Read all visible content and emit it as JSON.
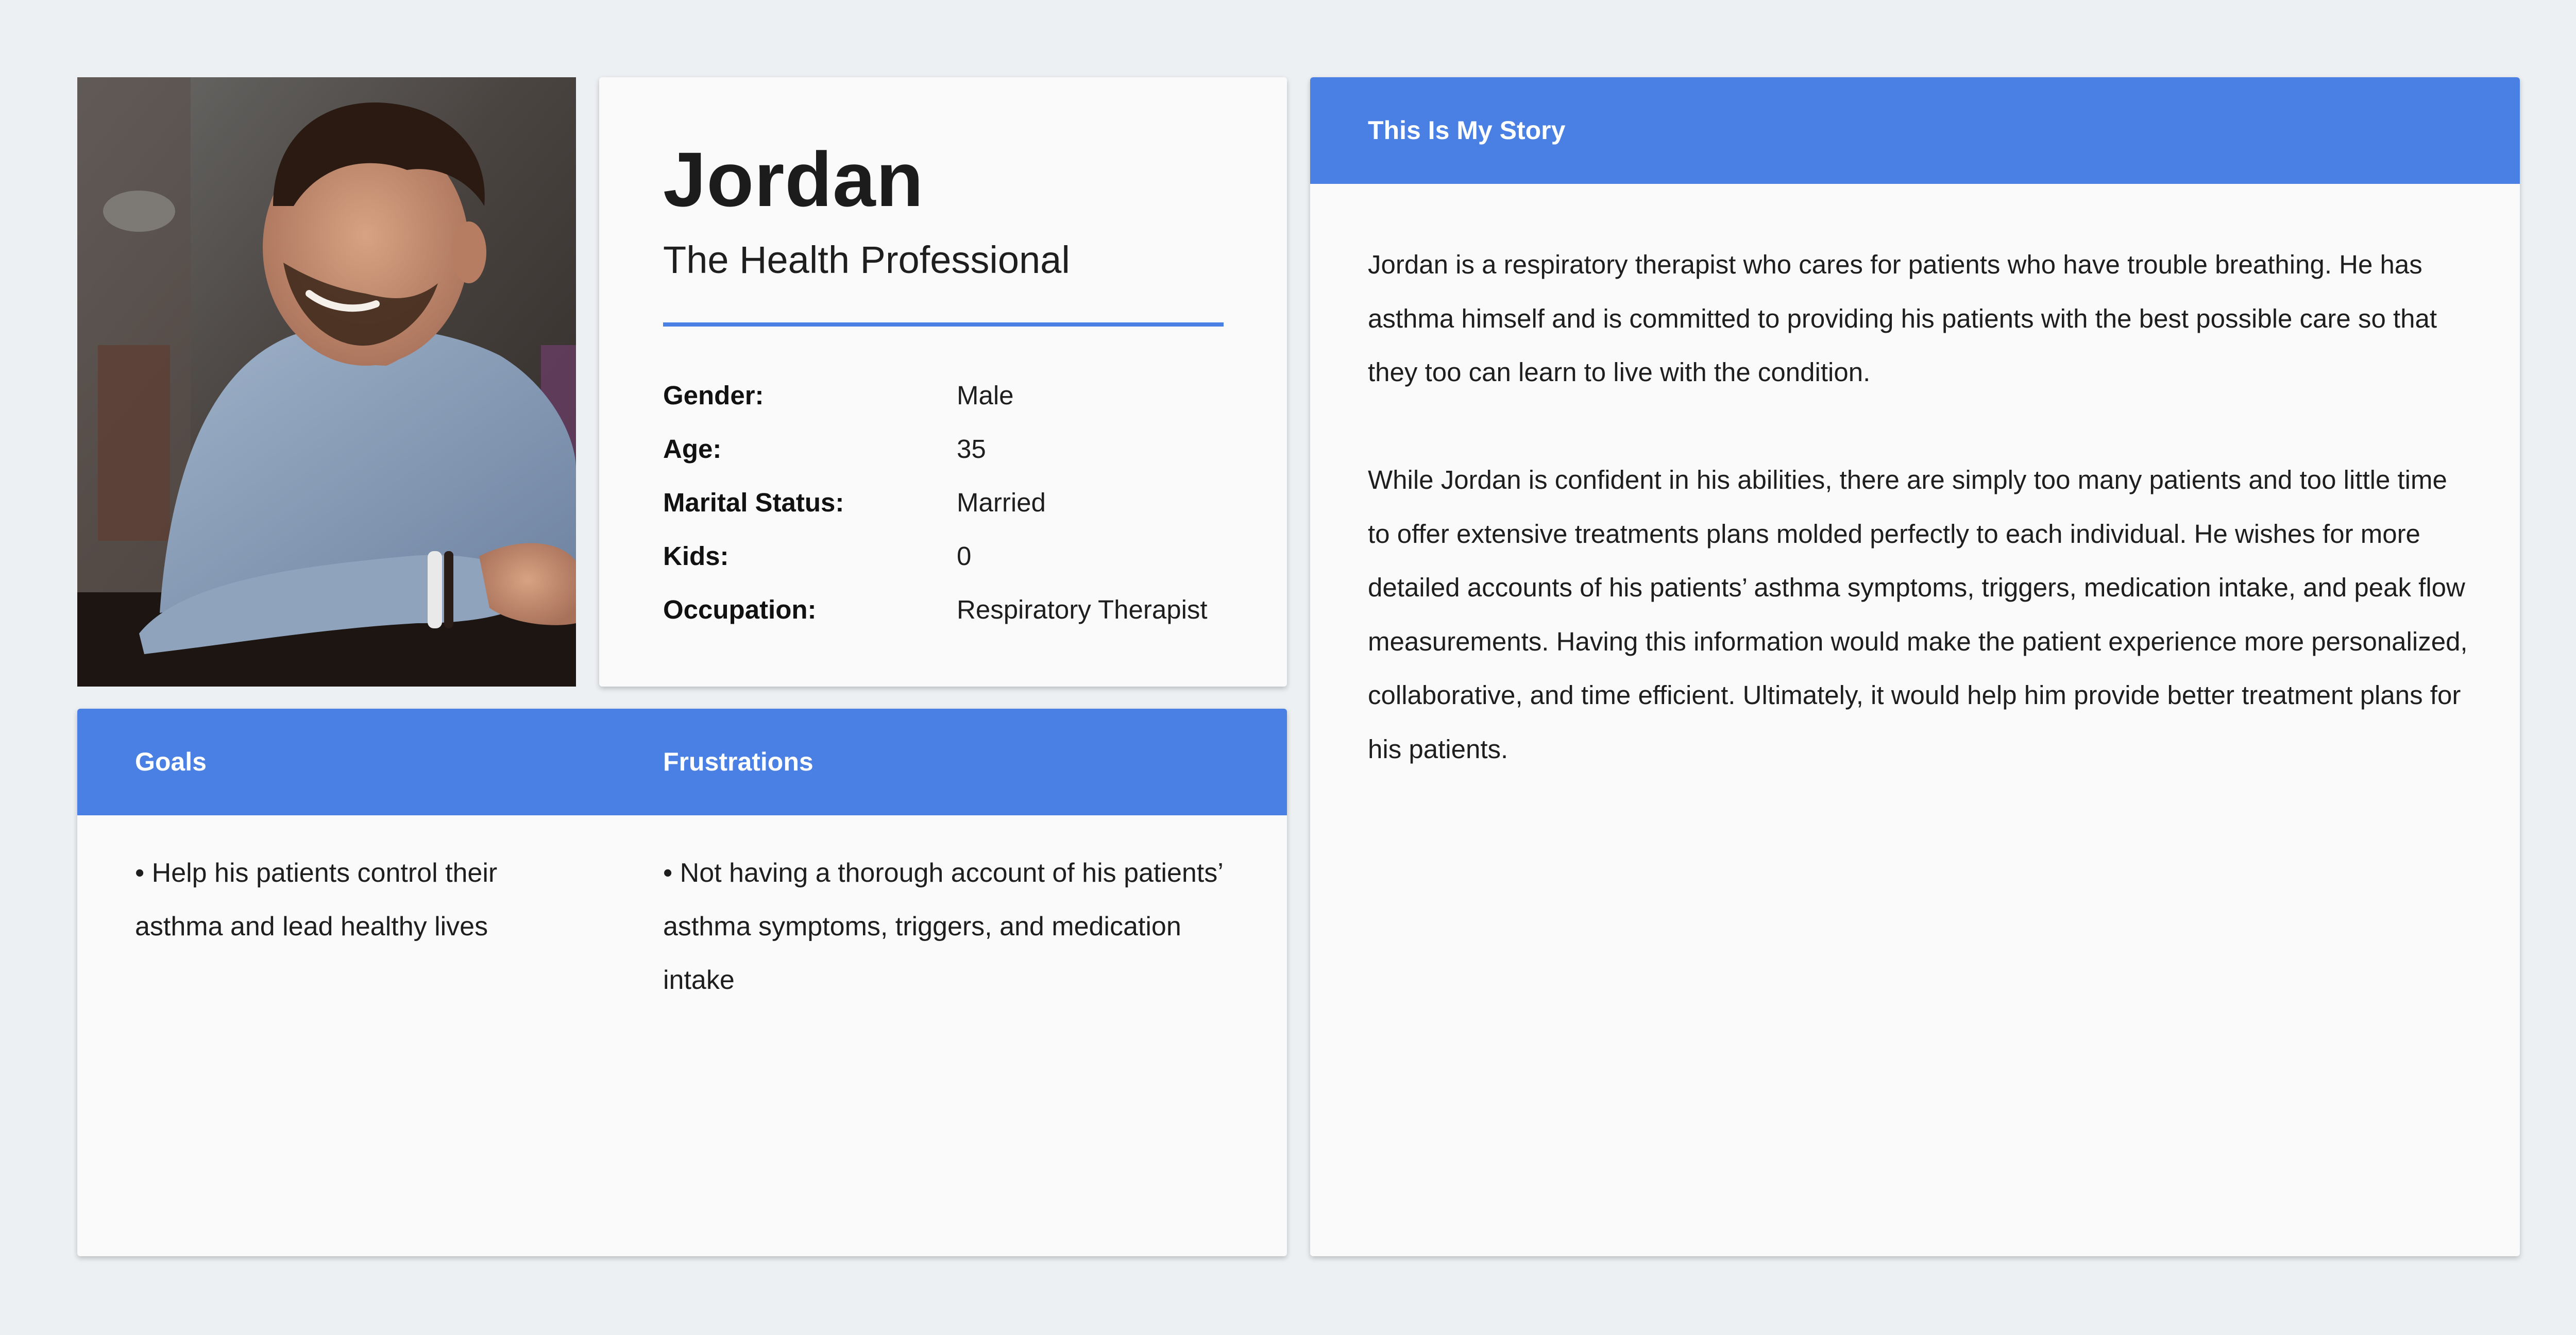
{
  "persona": {
    "name": "Jordan",
    "subtitle": "The Health Professional",
    "photo_icon": "portrait-photo",
    "facts": [
      {
        "label": "Gender:",
        "value": "Male"
      },
      {
        "label": "Age:",
        "value": "35"
      },
      {
        "label": "Marital Status:",
        "value": "Married"
      },
      {
        "label": "Kids:",
        "value": "0"
      },
      {
        "label": "Occupation:",
        "value": "Respiratory Therapist"
      }
    ]
  },
  "goals": {
    "title": "Goals",
    "items": [
      "• Help his patients control their asthma and lead healthy lives"
    ]
  },
  "frustrations": {
    "title": "Frustrations",
    "items": [
      "• Not having a thorough account of his patients’ asthma symptoms, triggers, and medication intake"
    ]
  },
  "story": {
    "title": "This Is My Story",
    "paragraphs": [
      "Jordan is a respiratory therapist who cares for patients who have trouble breathing. He has asthma himself and is committed to providing his patients with the best possible care so that they too can learn to live with the condition.",
      "While Jordan is confident in his abilities, there are simply too many patients and too little time to offer extensive treatments plans molded perfectly to each individual. He wishes for more detailed accounts of his patients’ asthma symptoms, triggers, medication intake, and peak flow measurements. Having this information would make the patient experience more personalized, collaborative, and time efficient. Ultimately, it would help him provide better treatment plans for his patients."
    ]
  },
  "colors": {
    "accent": "#4a7fe4",
    "background": "#edf0f3",
    "card": "#fafafa"
  }
}
